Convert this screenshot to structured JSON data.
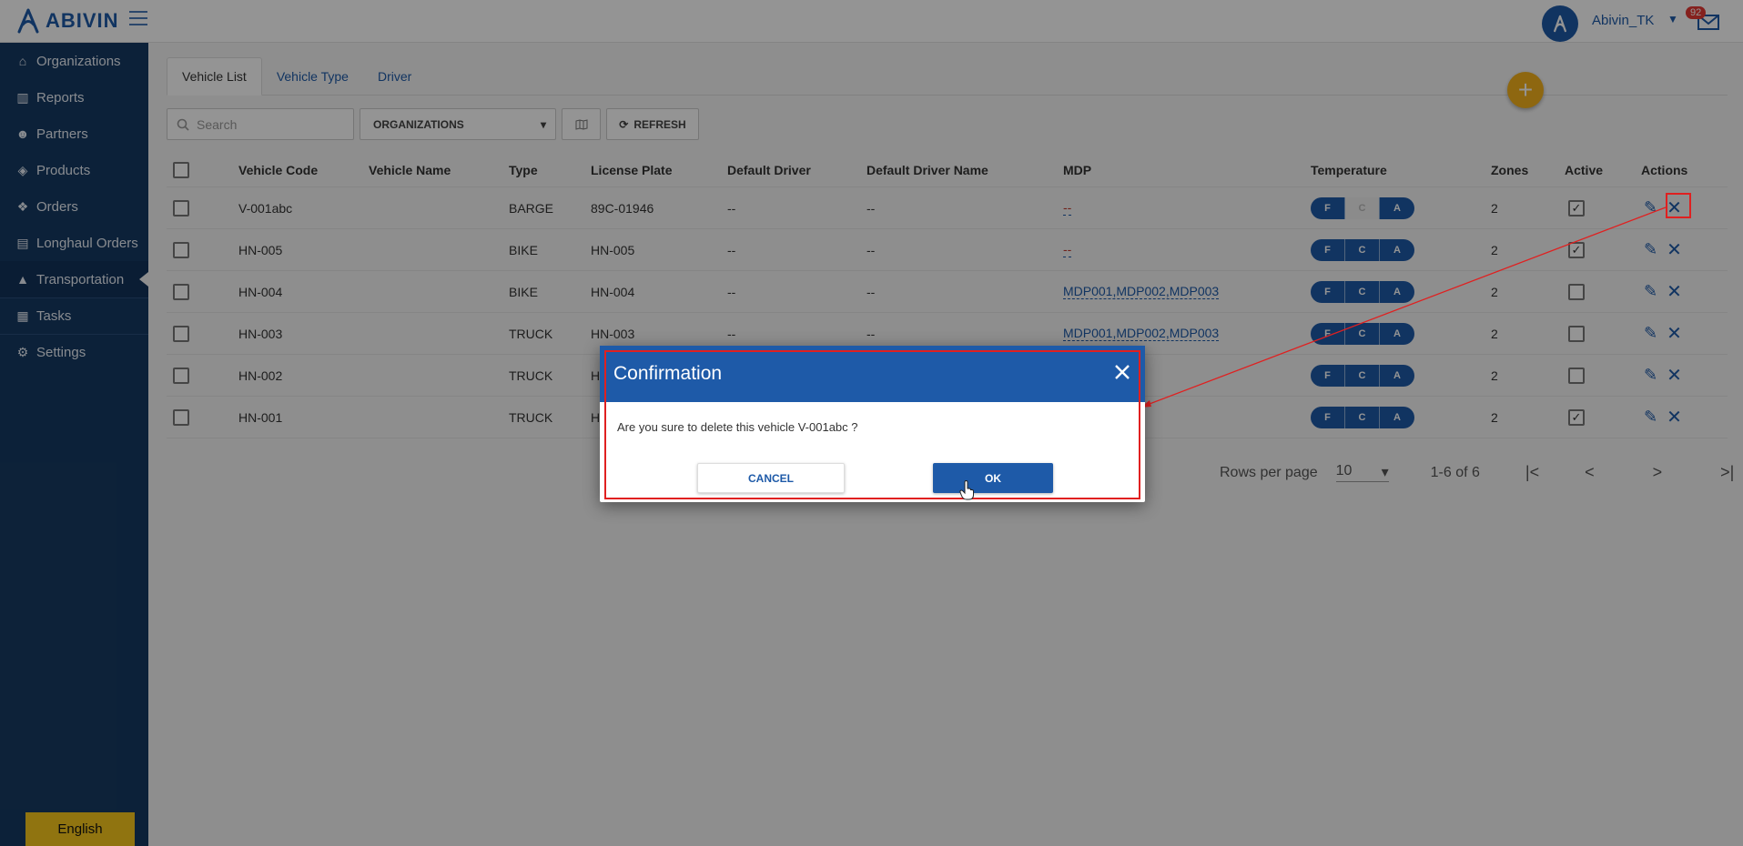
{
  "app": {
    "brand": "ABIVIN"
  },
  "header": {
    "user_name": "Abivin_TK",
    "notification_count": "92"
  },
  "sidebar": {
    "items": [
      {
        "label": "Organizations",
        "icon": "home-icon"
      },
      {
        "label": "Reports",
        "icon": "bar-chart-icon"
      },
      {
        "label": "Partners",
        "icon": "users-icon"
      },
      {
        "label": "Products",
        "icon": "dropbox-icon"
      },
      {
        "label": "Orders",
        "icon": "cubes-icon"
      },
      {
        "label": "Longhaul Orders",
        "icon": "list-icon"
      },
      {
        "label": "Transportation",
        "icon": "road-icon",
        "active": true
      },
      {
        "label": "Tasks",
        "icon": "calendar-icon"
      },
      {
        "label": "Settings",
        "icon": "gear-icon"
      }
    ],
    "language": "English"
  },
  "tabs": [
    "Vehicle List",
    "Vehicle Type",
    "Driver"
  ],
  "toolbar": {
    "search_placeholder": "Search",
    "org_select": "ORGANIZATIONS",
    "refresh_label": "REFRESH"
  },
  "table": {
    "columns": [
      "Vehicle Code",
      "Vehicle Name",
      "Type",
      "License Plate",
      "Default Driver",
      "Default Driver Name",
      "MDP",
      "Temperature",
      "Zones",
      "Active",
      "Actions"
    ],
    "temp_labels": [
      "F",
      "C",
      "A"
    ],
    "rows": [
      {
        "code": "V-001abc",
        "name": "",
        "type": "BARGE",
        "plate": "89C-01946",
        "driver": "--",
        "driver_name": "--",
        "mdp": "--",
        "temp_off": [
          false,
          true,
          false
        ],
        "zones": "2",
        "active": true
      },
      {
        "code": "HN-005",
        "name": "",
        "type": "BIKE",
        "plate": "HN-005",
        "driver": "--",
        "driver_name": "--",
        "mdp": "--",
        "temp_off": [
          false,
          false,
          false
        ],
        "zones": "2",
        "active": true
      },
      {
        "code": "HN-004",
        "name": "",
        "type": "BIKE",
        "plate": "HN-004",
        "driver": "--",
        "driver_name": "--",
        "mdp": "MDP001,MDP002,MDP003",
        "temp_off": [
          false,
          false,
          false
        ],
        "zones": "2",
        "active": false
      },
      {
        "code": "HN-003",
        "name": "",
        "type": "TRUCK",
        "plate": "HN-003",
        "driver": "--",
        "driver_name": "--",
        "mdp": "MDP001,MDP002,MDP003",
        "temp_off": [
          false,
          false,
          false
        ],
        "zones": "2",
        "active": false
      },
      {
        "code": "HN-002",
        "name": "",
        "type": "TRUCK",
        "plate": "H",
        "driver": "",
        "driver_name": "",
        "mdp": "",
        "temp_off": [
          false,
          false,
          false
        ],
        "zones": "2",
        "active": false
      },
      {
        "code": "HN-001",
        "name": "",
        "type": "TRUCK",
        "plate": "H",
        "driver": "",
        "driver_name": "",
        "mdp": "",
        "temp_off": [
          false,
          false,
          false
        ],
        "zones": "2",
        "active": true
      }
    ]
  },
  "pagination": {
    "rows_per_page_label": "Rows per page",
    "rows_per_page": "10",
    "range": "1-6 of 6"
  },
  "dialog": {
    "title": "Confirmation",
    "message": "Are you sure to delete this vehicle V-001abc ?",
    "cancel_label": "CANCEL",
    "ok_label": "OK"
  },
  "colors": {
    "primary": "#1e5aa8",
    "sidebar": "#163a63",
    "accent": "#f5b21c",
    "highlight": "#e02020"
  }
}
